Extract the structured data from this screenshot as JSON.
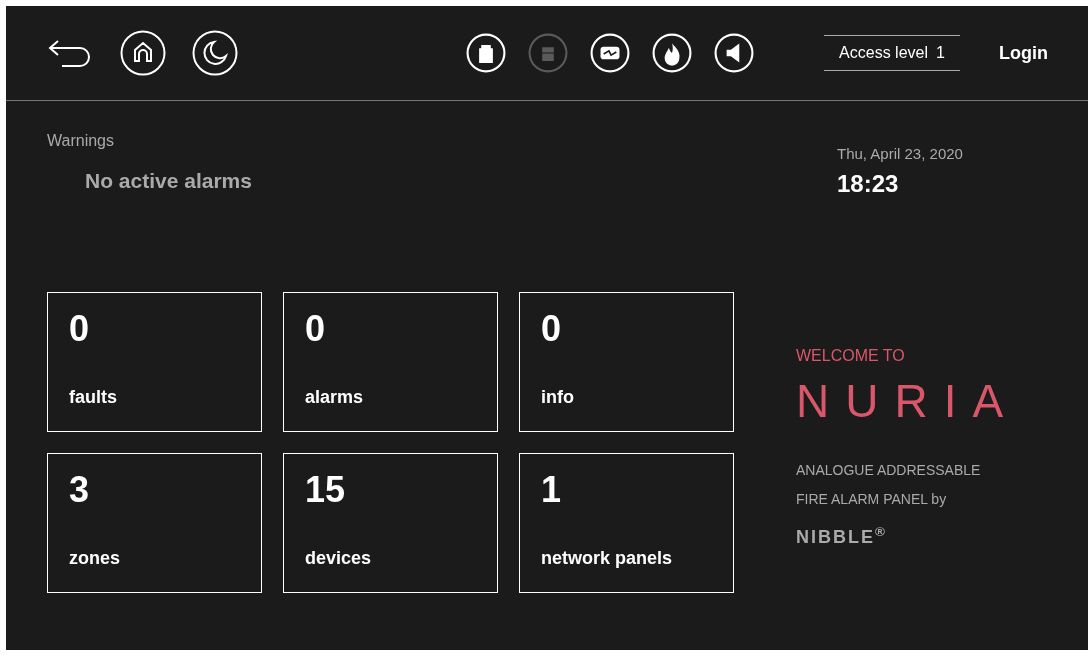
{
  "nav_buttons": [
    {
      "kind": "back"
    },
    {
      "kind": "home"
    },
    {
      "kind": "night"
    }
  ],
  "status_icons": [
    {
      "kind": "usb",
      "disabled": false
    },
    {
      "kind": "card",
      "disabled": true
    },
    {
      "kind": "battery",
      "disabled": false
    },
    {
      "kind": "fire",
      "disabled": false
    },
    {
      "kind": "sounder",
      "disabled": false
    }
  ],
  "access_level": {
    "label": "Access level",
    "value": "1"
  },
  "login": "Login",
  "warnings": {
    "title": "Warnings",
    "message": "No active alarms"
  },
  "datetime": {
    "date": "Thu, April 23, 2020",
    "time": "18:23"
  },
  "tiles": [
    {
      "count": "0",
      "label": "faults"
    },
    {
      "count": "0",
      "label": "alarms"
    },
    {
      "count": "0",
      "label": "info"
    },
    {
      "count": "3",
      "label": "zones"
    },
    {
      "count": "15",
      "label": "devices"
    },
    {
      "count": "1",
      "label": "network panels"
    }
  ],
  "branding": {
    "welcome": "WELCOME TO",
    "product": "NURIA",
    "tagline_1": "ANALOGUE ADDRESSABLE",
    "tagline_2": "FIRE ALARM PANEL by",
    "maker": "NIBBLE",
    "maker_mark": "®"
  }
}
